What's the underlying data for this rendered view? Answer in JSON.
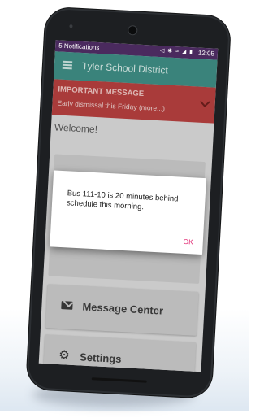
{
  "status_bar": {
    "notifications": "5 Notifications",
    "icons": "◁ ✱ ≈ ◢ ▮",
    "time": "12:05"
  },
  "app_bar": {
    "title": "Tyler School District"
  },
  "banner": {
    "title": "IMPORTANT MESSAGE",
    "text": "Early dismissal this Friday (more...)"
  },
  "welcome": "Welcome!",
  "menu": {
    "message_center": "Message Center",
    "settings": "Settings"
  },
  "dialog": {
    "message": "Bus 111-10 is 20 minutes behind schedule this morning.",
    "ok": "OK"
  },
  "colors": {
    "status_bar": "#4a2a5e",
    "app_bar": "#3f8f86",
    "banner": "#b8413f",
    "dialog_button": "#e0246f"
  },
  "icons": [
    "hamburger-icon",
    "chevron-down-icon",
    "envelope-icon",
    "gear-icon"
  ]
}
